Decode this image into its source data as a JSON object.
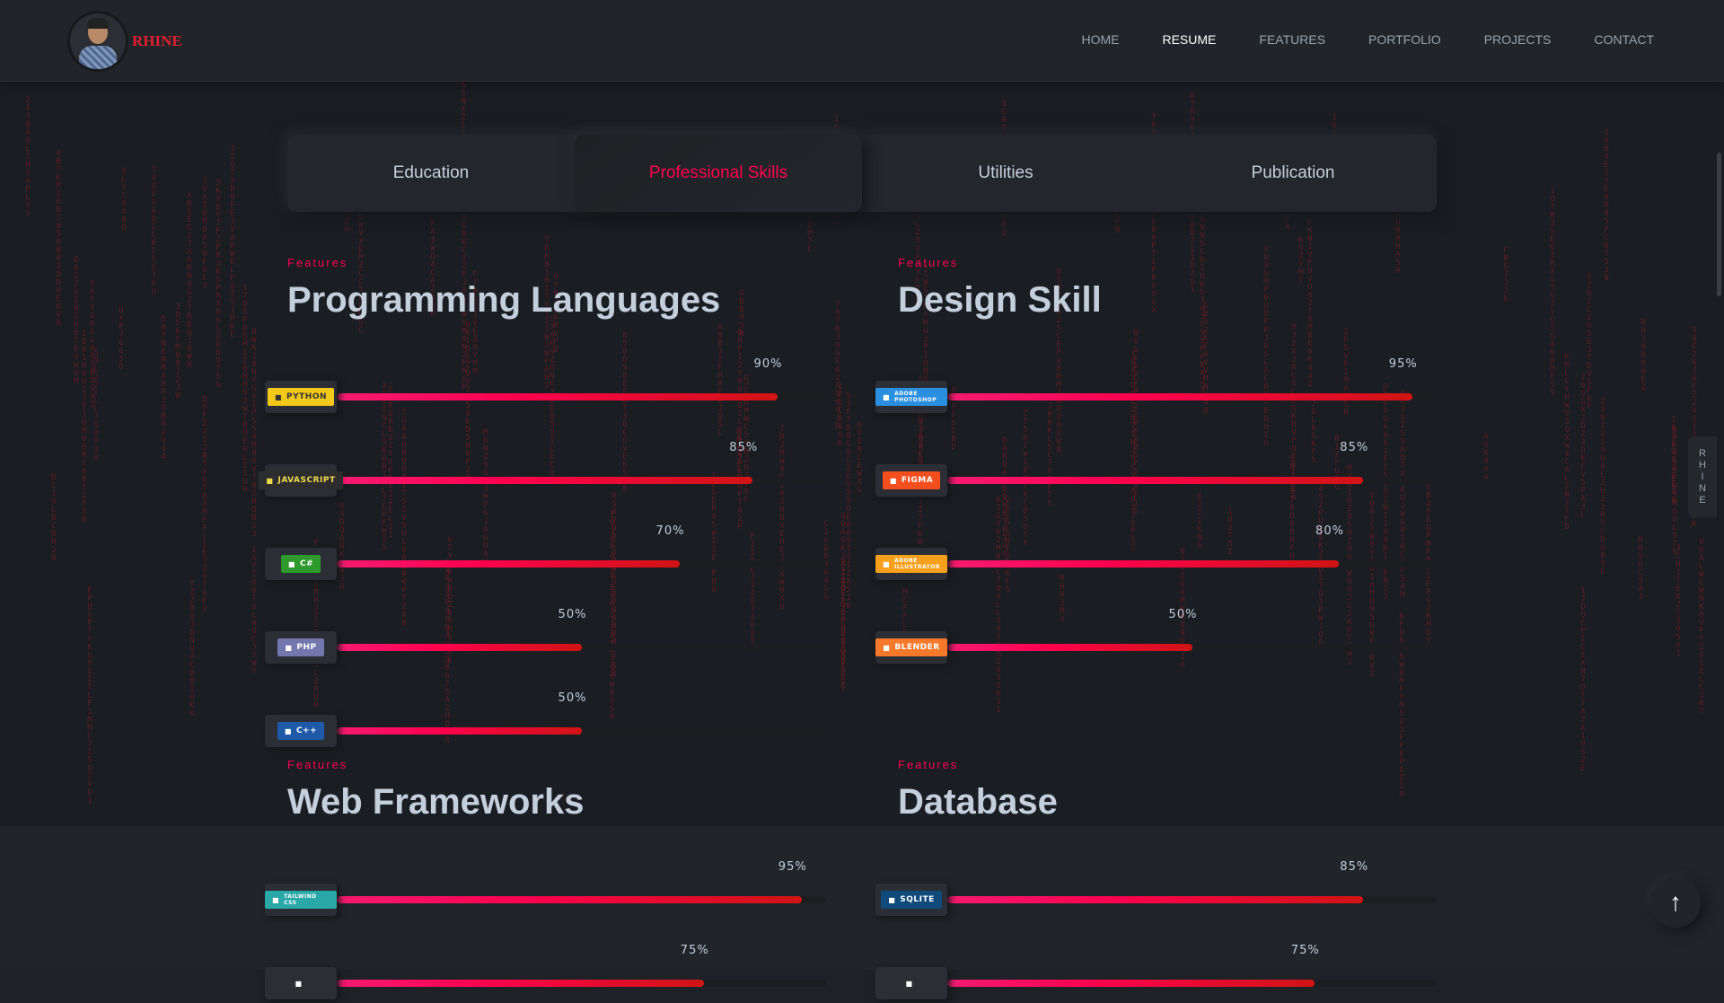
{
  "header": {
    "brand": "RHINE",
    "nav": [
      "HOME",
      "RESUME",
      "FEATURES",
      "PORTFOLIO",
      "PROJECTS",
      "CONTACT"
    ],
    "active_nav": "RESUME"
  },
  "tabs": [
    "Education",
    "Professional Skills",
    "Utilities",
    "Publication"
  ],
  "active_tab": "Professional Skills",
  "sections": {
    "programming": {
      "subtitle": "Features",
      "title": "Programming Languages",
      "skills": [
        {
          "label": "PYTHON",
          "percent": "90%",
          "value": 90,
          "color": "#f2c81a",
          "text_color": "#333",
          "icon": "python-icon"
        },
        {
          "label": "JAVASCRIPT",
          "percent": "85%",
          "value": 85,
          "color": "#2d2d2d",
          "text_color": "#f0db4f",
          "icon": "javascript-icon"
        },
        {
          "label": "C#",
          "percent": "70%",
          "value": 70,
          "color": "#2e9a2e",
          "text_color": "#fff",
          "icon": "csharp-icon"
        },
        {
          "label": "PHP",
          "percent": "50%",
          "value": 50,
          "color": "#7377ad",
          "text_color": "#fff",
          "icon": "php-icon"
        },
        {
          "label": "C++",
          "percent": "50%",
          "value": 50,
          "color": "#1f5aa8",
          "text_color": "#fff",
          "icon": "cpp-icon"
        }
      ]
    },
    "design": {
      "subtitle": "Features",
      "title": "Design Skill",
      "skills": [
        {
          "label": "ADOBE PHOTOSHOP",
          "percent": "95%",
          "value": 95,
          "color": "#2b8fe0",
          "text_color": "#fff",
          "icon": "photoshop-icon"
        },
        {
          "label": "FIGMA",
          "percent": "85%",
          "value": 85,
          "color": "#f24e1e",
          "text_color": "#fff",
          "icon": "figma-icon"
        },
        {
          "label": "ADOBE ILLUSTRATOR",
          "percent": "80%",
          "value": 80,
          "color": "#f7a01c",
          "text_color": "#fff",
          "icon": "illustrator-icon"
        },
        {
          "label": "BLENDER",
          "percent": "50%",
          "value": 50,
          "color": "#f5792a",
          "text_color": "#fff",
          "icon": "blender-icon"
        }
      ]
    },
    "web": {
      "subtitle": "Features",
      "title": "Web Frameworks",
      "skills": [
        {
          "label": "TAILWIND CSS",
          "percent": "95%",
          "value": 95,
          "color": "#2aa7a7",
          "text_color": "#fff",
          "icon": "tailwind-icon"
        },
        {
          "label": "",
          "percent": "75%",
          "value": 75,
          "color": "#2b2f35",
          "text_color": "#fff",
          "icon": "framework-icon"
        }
      ]
    },
    "database": {
      "subtitle": "Features",
      "title": "Database",
      "skills": [
        {
          "label": "SQLITE",
          "percent": "85%",
          "value": 85,
          "color": "#0f4a7a",
          "text_color": "#fff",
          "icon": "sqlite-icon"
        },
        {
          "label": "",
          "percent": "75%",
          "value": 75,
          "color": "#2b2f35",
          "text_color": "#fff",
          "icon": "database-icon"
        }
      ]
    }
  },
  "side_label": [
    "R",
    "H",
    "I",
    "N",
    "E"
  ],
  "scroll_top_icon": "arrow-up-icon"
}
